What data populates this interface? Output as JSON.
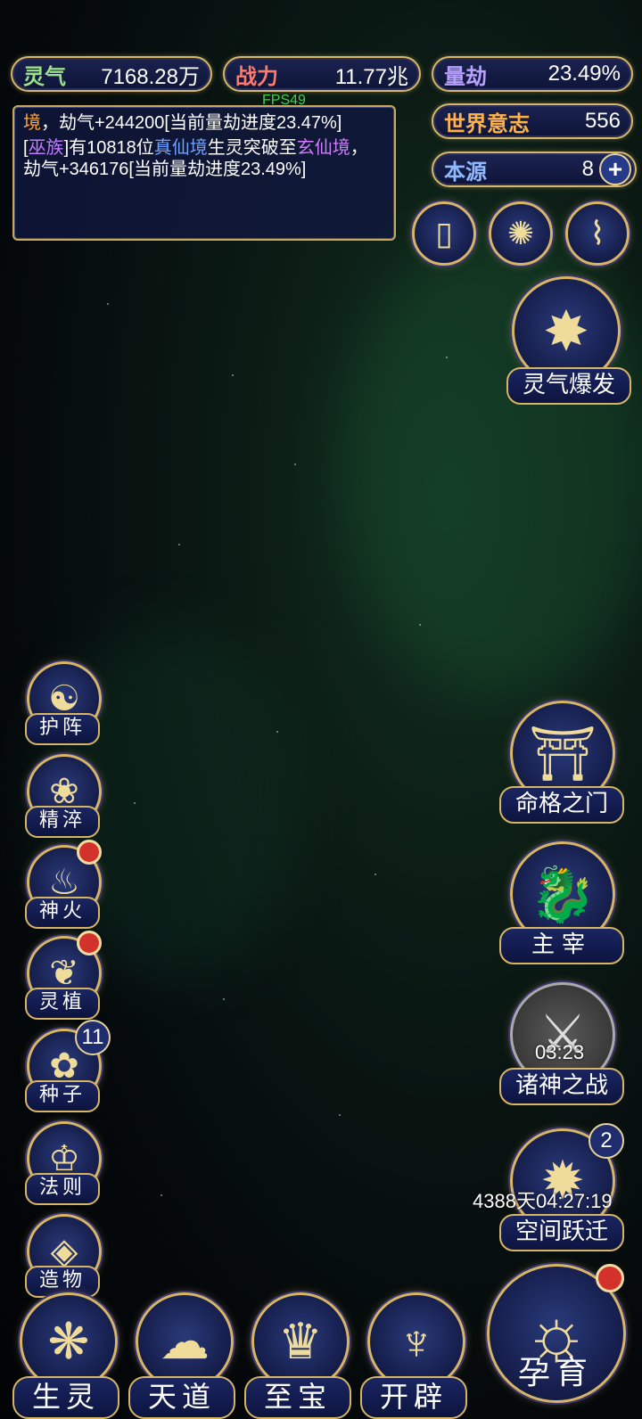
{
  "resources": {
    "lingqi": {
      "label": "灵气",
      "value": "7168.28万"
    },
    "zhanli": {
      "label": "战力",
      "value": "11.77兆"
    },
    "liangjie": {
      "label": "量劫",
      "value": "23.49%"
    },
    "world_will": {
      "label": "世界意志",
      "value": "556"
    },
    "benyuan": {
      "label": "本源",
      "value": "8"
    }
  },
  "fps": "FPS49",
  "log": {
    "line1_a": "境",
    "line1_b": "，劫气+244200[当前量劫进度23.47%]",
    "line2_a": "[",
    "line2_race": "巫族",
    "line2_b": "]有10818位",
    "line2_realm1": "真仙境",
    "line2_c": "生灵突破至",
    "line2_realm2": "玄仙境",
    "line2_d": "，劫气+346176[当前量劫进度23.49%]"
  },
  "top_icons": [
    {
      "name": "cards-icon",
      "glyph": "▯"
    },
    {
      "name": "swirl-icon",
      "glyph": "✺"
    },
    {
      "name": "scroll-icon",
      "glyph": "⌇"
    }
  ],
  "burst": {
    "label": "灵气爆发"
  },
  "left_menu": [
    {
      "label": "护阵",
      "glyph": "☯"
    },
    {
      "label": "精淬",
      "glyph": "❀"
    },
    {
      "label": "神火",
      "glyph": "♨",
      "dot": true
    },
    {
      "label": "灵植",
      "glyph": "❦",
      "dot": true
    },
    {
      "label": "种子",
      "glyph": "✿",
      "badge": "11"
    },
    {
      "label": "法则",
      "glyph": "♔"
    },
    {
      "label": "造物",
      "glyph": "◈"
    }
  ],
  "right_menu": {
    "gate": {
      "label": "命格之门",
      "glyph": "⛩"
    },
    "master": {
      "label": "主宰",
      "glyph": "🐉"
    },
    "war": {
      "label": "诸神之战",
      "glyph": "⚔",
      "timer": "03:23"
    },
    "leap": {
      "label": "空间跃迁",
      "glyph": "✹",
      "badge": "2",
      "timer": "4388天04:27:19"
    }
  },
  "bottom_menu": [
    {
      "label": "生灵",
      "glyph": "❋"
    },
    {
      "label": "天道",
      "glyph": "☁"
    },
    {
      "label": "至宝",
      "glyph": "♛"
    },
    {
      "label": "开辟",
      "glyph": "♆"
    }
  ],
  "yunyu": {
    "label": "孕育",
    "glyph": "☼"
  }
}
